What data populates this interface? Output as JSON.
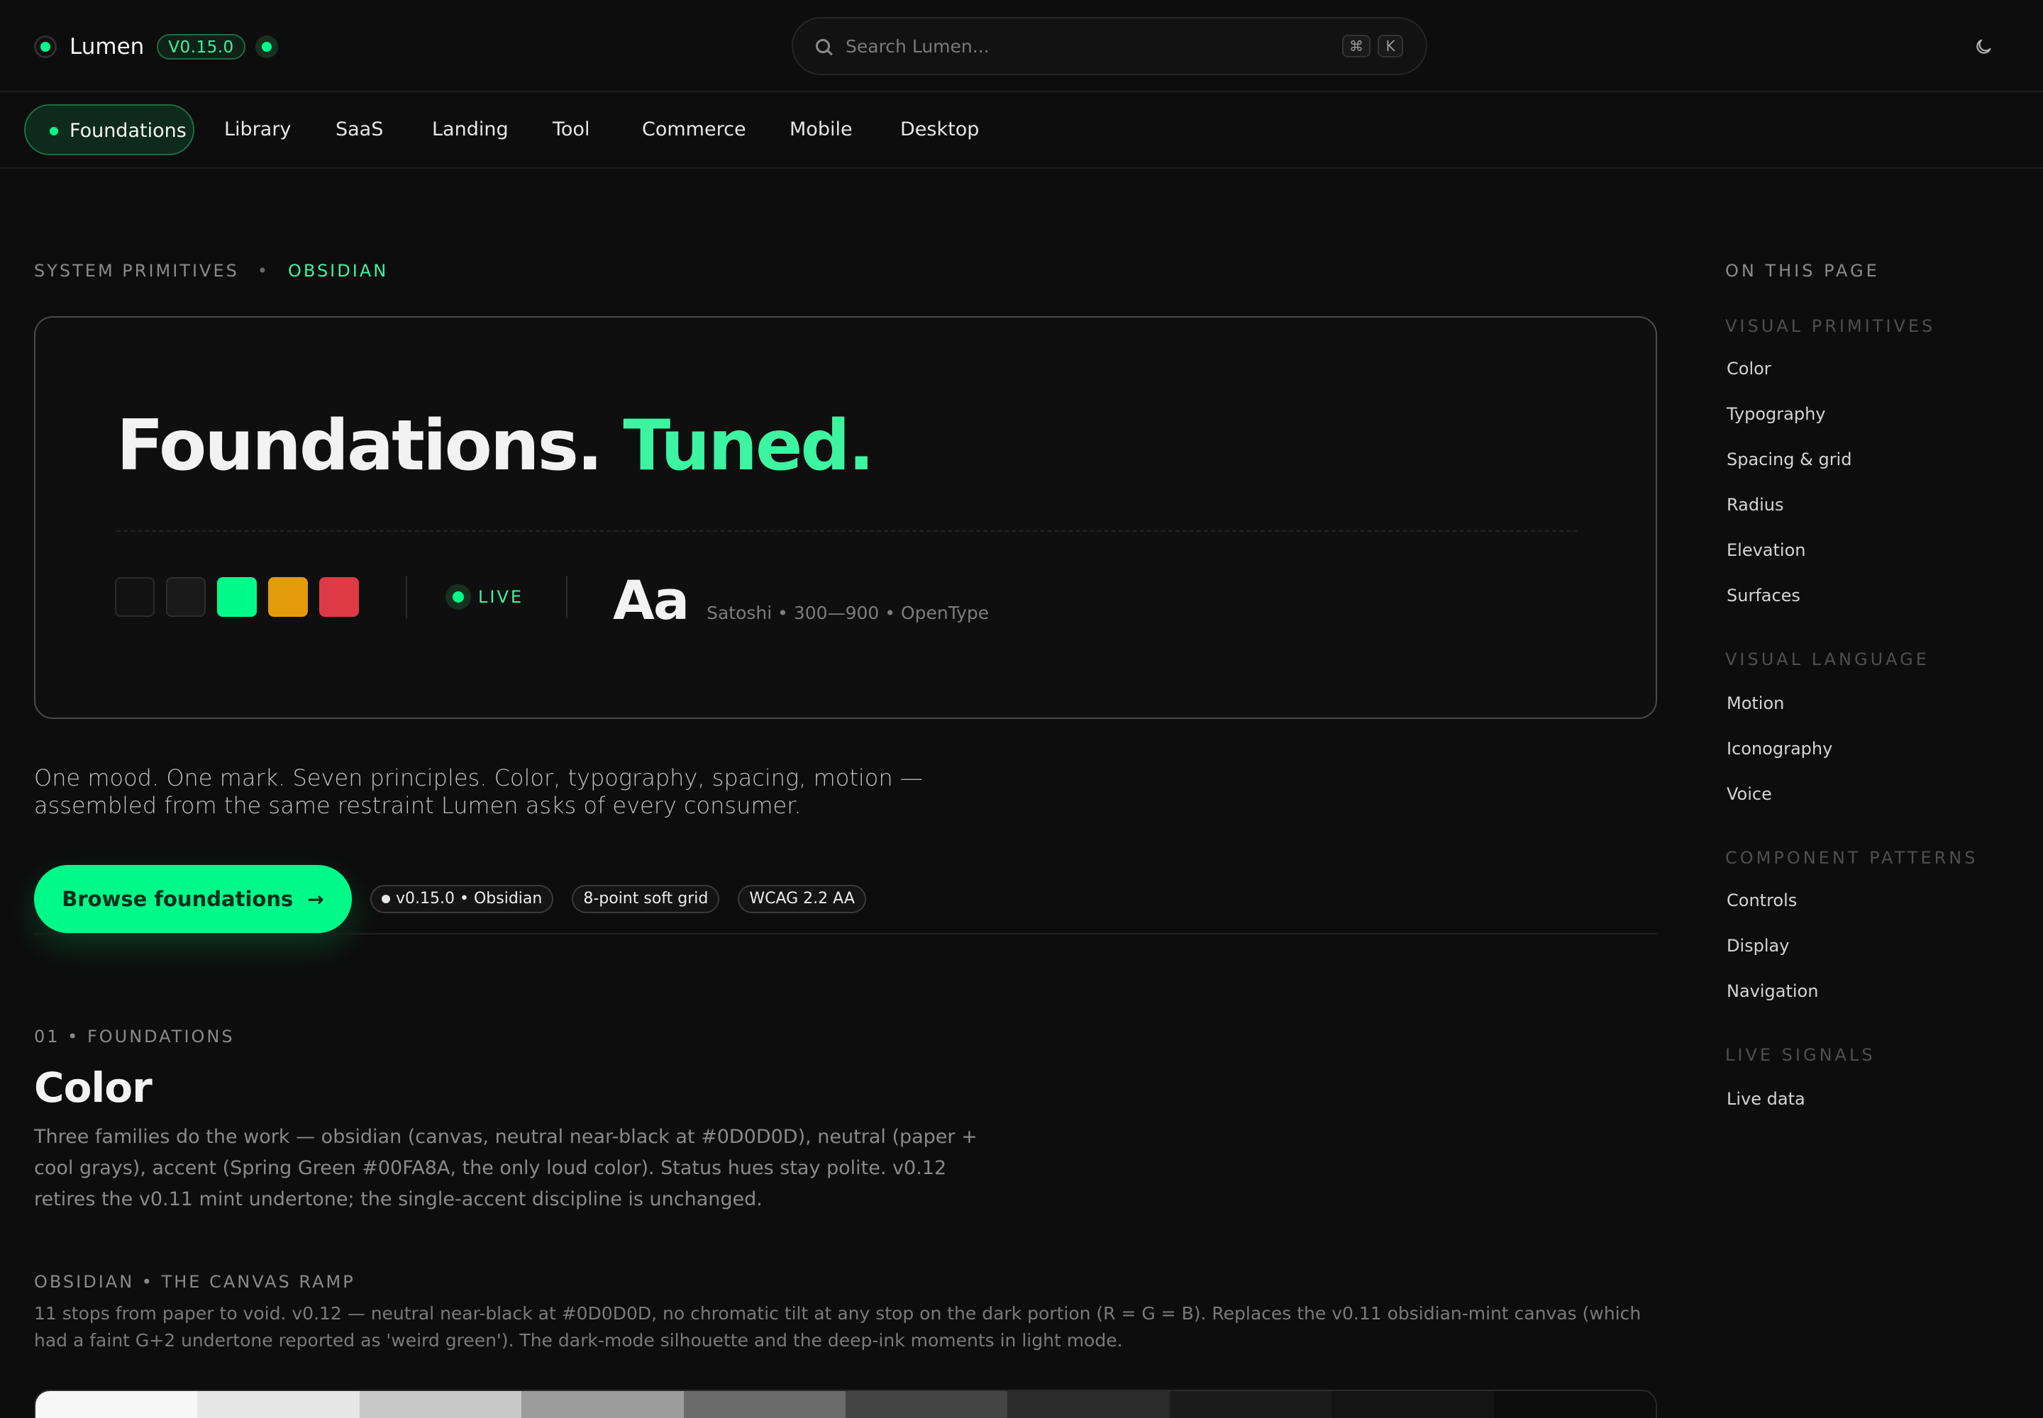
{
  "brand": {
    "name": "Lumen",
    "version": "V0.15.0"
  },
  "search": {
    "placeholder": "Search Lumen...",
    "shortcut_mod": "⌘",
    "shortcut_key": "K"
  },
  "nav": {
    "items": [
      {
        "label": "Foundations",
        "active": true
      },
      {
        "label": "Library"
      },
      {
        "label": "SaaS"
      },
      {
        "label": "Landing"
      },
      {
        "label": "Tool"
      },
      {
        "label": "Commerce"
      },
      {
        "label": "Mobile"
      },
      {
        "label": "Desktop"
      }
    ]
  },
  "eyebrow": {
    "primary": "SYSTEM PRIMITIVES",
    "separator": "•",
    "accent": "OBSIDIAN"
  },
  "hero": {
    "title_main": "Foundations.",
    "title_accent": "Tuned.",
    "swatch_colors": [
      "#121212",
      "#1a1a1a",
      "#00fa8a",
      "#e39a0b",
      "#dd3a46"
    ],
    "live_label": "LIVE",
    "type_sample": "Aa",
    "type_meta": "Satoshi • 300—900 • OpenType"
  },
  "lede": "One mood. One mark. Seven principles. Color, typography, spacing, motion — assembled from the same restraint Lumen asks of every consumer.",
  "cta": {
    "label": "Browse foundations",
    "arrow": "→"
  },
  "chips": [
    "v0.15.0 • Obsidian",
    "8-point soft grid",
    "WCAG 2.2 AA"
  ],
  "section": {
    "eyebrow": "01 • FOUNDATIONS",
    "title": "Color",
    "body": "Three families do the work — obsidian (canvas, neutral near-black at #0D0D0D), neutral (paper + cool grays), accent (Spring Green #00FA8A, the only loud color). Status hues stay polite. v0.12 retires the v0.11 mint undertone; the single-accent discipline is unchanged.",
    "sub_eyebrow": "OBSIDIAN • THE CANVAS RAMP",
    "sub_body": "11 stops from paper to void. v0.12 — neutral near-black at #0D0D0D, no chromatic tilt at any stop on the dark portion (R = G = B). Replaces the v0.11 obsidian-mint canvas (which had a faint G+2 undertone reported as 'weird green'). The dark-mode silhouette and the deep-ink moments in light mode.",
    "ramp_colors": [
      "#f7f7f7",
      "#e6e6e6",
      "#c7c7c7",
      "#9c9c9c",
      "#6b6b6b",
      "#444444",
      "#2b2b2b",
      "#1c1c1c",
      "#141414",
      "#0d0d0d"
    ]
  },
  "toc": {
    "heading": "ON THIS PAGE",
    "groups": [
      {
        "label": "VISUAL PRIMITIVES",
        "links": [
          "Color",
          "Typography",
          "Spacing & grid",
          "Radius",
          "Elevation",
          "Surfaces"
        ]
      },
      {
        "label": "VISUAL LANGUAGE",
        "links": [
          "Motion",
          "Iconography",
          "Voice"
        ]
      },
      {
        "label": "COMPONENT PATTERNS",
        "links": [
          "Controls",
          "Display",
          "Navigation"
        ]
      },
      {
        "label": "LIVE SIGNALS",
        "links": [
          "Live data"
        ]
      }
    ]
  },
  "colors": {
    "accent": "#00fa8a",
    "canvas": "#0d0d0d"
  }
}
